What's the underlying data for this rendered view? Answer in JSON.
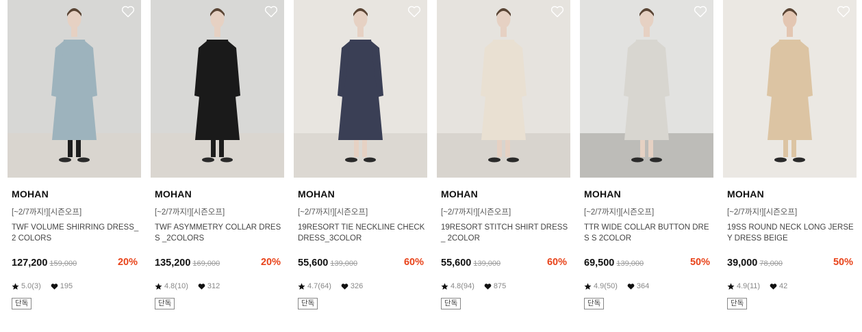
{
  "products": [
    {
      "brand": "MOHAN",
      "promo": "[~2/7까지!][시즌오프]",
      "name": "TWF VOLUME SHIRRING DRESS_2 COLORS",
      "price": "127,200",
      "original_price": "159,000",
      "discount": "20%",
      "rating": "5.0(3)",
      "likes": "195",
      "badge": "단독",
      "image": {
        "wall": "#d7d7d5",
        "floor": "#d9d5cf",
        "dress": "#9db3bd",
        "legs": "#1c1c1c",
        "skin": "#e6d1c3"
      }
    },
    {
      "brand": "MOHAN",
      "promo": "[~2/7까지!][시즌오프]",
      "name": "TWF ASYMMETRY COLLAR DRESS _2COLORS",
      "price": "135,200",
      "original_price": "169,000",
      "discount": "20%",
      "rating": "4.8(10)",
      "likes": "312",
      "badge": "단독",
      "image": {
        "wall": "#d8d8d6",
        "floor": "#dad6d0",
        "dress": "#1a1a1a",
        "legs": "#1c1c1c",
        "skin": "#e6d1c3"
      }
    },
    {
      "brand": "MOHAN",
      "promo": "[~2/7까지!][시즌오프]",
      "name": "19RESORT TIE NECKLINE CHECK DRESS_3COLOR",
      "price": "55,600",
      "original_price": "139,000",
      "discount": "60%",
      "rating": "4.7(64)",
      "likes": "326",
      "badge": "단독",
      "image": {
        "wall": "#e8e5e0",
        "floor": "#dcd8d2",
        "dress": "#3a3f55",
        "legs": "#e6d1c3",
        "skin": "#e6d1c3"
      }
    },
    {
      "brand": "MOHAN",
      "promo": "[~2/7까지!][시즌오프]",
      "name": "19RESORT STITCH SHIRT DRESS_ 2COLOR",
      "price": "55,600",
      "original_price": "139,000",
      "discount": "60%",
      "rating": "4.8(94)",
      "likes": "875",
      "badge": "단독",
      "image": {
        "wall": "#e6e3de",
        "floor": "#d8d4ce",
        "dress": "#e9e0d2",
        "legs": "#e6d1c3",
        "skin": "#e6d1c3"
      }
    },
    {
      "brand": "MOHAN",
      "promo": "[~2/7까지!][시즌오프]",
      "name": "TTR WIDE COLLAR BUTTON DRES S 2COLOR",
      "price": "69,500",
      "original_price": "139,000",
      "discount": "50%",
      "rating": "4.9(50)",
      "likes": "364",
      "badge": "단독",
      "image": {
        "wall": "#e2e2e0",
        "floor": "#bdbcb8",
        "dress": "#d8d6d0",
        "legs": "#e6d1c3",
        "skin": "#e6d1c3"
      }
    },
    {
      "brand": "MOHAN",
      "promo": "[~2/7까지!][시즌오프]",
      "name": "19SS ROUND NECK LONG JERSEY DRESS BEIGE",
      "price": "39,000",
      "original_price": "78,000",
      "discount": "50%",
      "rating": "4.9(11)",
      "likes": "42",
      "badge": "단독",
      "image": {
        "wall": "#ebe8e3",
        "floor": "#ebe8e3",
        "dress": "#dcc4a3",
        "legs": "#dcc4a3",
        "skin": "#e3c6b2"
      }
    }
  ],
  "icons": {
    "wishlist": "heart-outline-icon",
    "rating": "star-icon",
    "likes": "heart-icon"
  },
  "colors": {
    "discount": "#e8431a",
    "price": "#111111",
    "muted": "#888888"
  }
}
